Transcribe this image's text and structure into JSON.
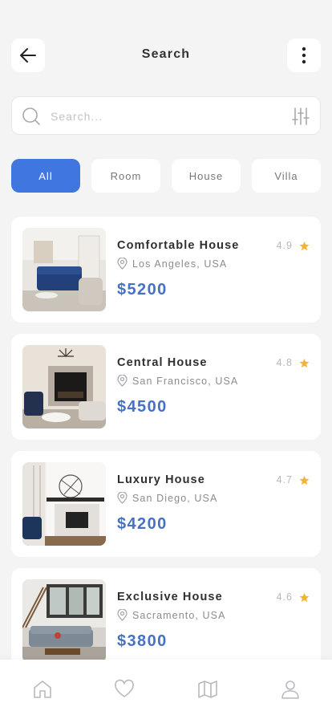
{
  "header": {
    "title": "Search",
    "back_icon": "arrow-left-icon",
    "more_icon": "more-vertical-icon"
  },
  "search": {
    "placeholder": "Search...",
    "value": "",
    "search_icon": "search-icon",
    "filter_icon": "sliders-icon"
  },
  "filters": {
    "active": "All",
    "items": [
      {
        "label": "All"
      },
      {
        "label": "Room"
      },
      {
        "label": "House"
      },
      {
        "label": "Villa"
      }
    ]
  },
  "listings": [
    {
      "name": "Comfortable House",
      "location": "Los Angeles, USA",
      "price": "$5200",
      "rating": "4.9",
      "photo": "blue-sofa-living-room"
    },
    {
      "name": "Central House",
      "location": "San Francisco, USA",
      "price": "$4500",
      "rating": "4.8",
      "photo": "fireplace-living-room"
    },
    {
      "name": "Luxury House",
      "location": "San Diego, USA",
      "price": "$4200",
      "rating": "4.7",
      "photo": "modern-fireplace-room"
    },
    {
      "name": "Exclusive House",
      "location": "Sacramento, USA",
      "price": "$3800",
      "rating": "4.6",
      "photo": "loft-living-room"
    }
  ],
  "bottom_nav": {
    "items": [
      {
        "icon": "home-icon"
      },
      {
        "icon": "heart-icon"
      },
      {
        "icon": "map-icon"
      },
      {
        "icon": "user-icon"
      }
    ]
  },
  "colors": {
    "accent": "#3f76e0",
    "price": "#4672c4",
    "star": "#f5b335",
    "background": "#f4f4f5",
    "card": "#ffffff"
  }
}
